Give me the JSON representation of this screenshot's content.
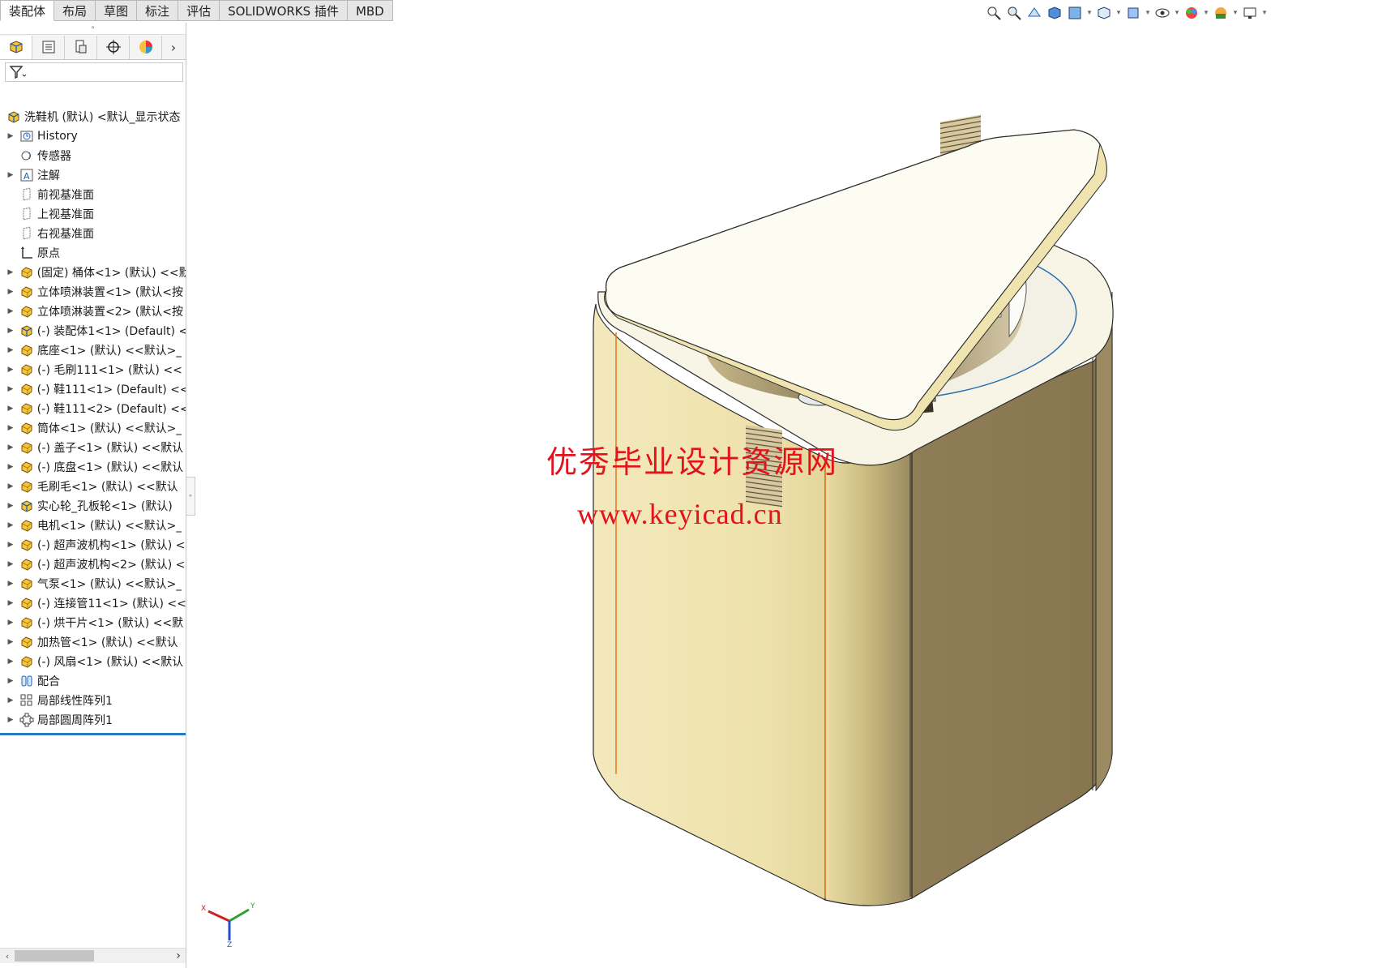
{
  "tabs": [
    {
      "label": "装配体",
      "active": true
    },
    {
      "label": "布局",
      "active": false
    },
    {
      "label": "草图",
      "active": false
    },
    {
      "label": "标注",
      "active": false
    },
    {
      "label": "评估",
      "active": false
    },
    {
      "label": "SOLIDWORKS 插件",
      "active": false
    },
    {
      "label": "MBD",
      "active": false
    }
  ],
  "view_toolbar": {
    "icons": [
      "zoom-to-fit-icon",
      "zoom-to-area-icon",
      "previous-view-icon",
      "section-view-icon",
      "dynamic-annotation-icon",
      "view-orientation-icon",
      "display-style-icon",
      "hide-show-items-icon",
      "edit-appearance-icon",
      "apply-scene-icon",
      "view-settings-icon"
    ]
  },
  "panel": {
    "manager_tabs": [
      "featuremanager-tree-icon",
      "propertymanager-icon",
      "configurationmanager-icon",
      "dimxpertmanager-icon",
      "displaymanager-icon"
    ],
    "root_label": "洗鞋机 (默认) <默认_显示状态",
    "tree": [
      {
        "label": "History",
        "icon": "history-icon",
        "expand": true
      },
      {
        "label": "传感器",
        "icon": "sensor-icon",
        "expand": false
      },
      {
        "label": "注解",
        "icon": "annotation-icon",
        "expand": true
      },
      {
        "label": "前视基准面",
        "icon": "plane-icon",
        "expand": false
      },
      {
        "label": "上视基准面",
        "icon": "plane-icon",
        "expand": false
      },
      {
        "label": "右视基准面",
        "icon": "plane-icon",
        "expand": false
      },
      {
        "label": "原点",
        "icon": "origin-icon",
        "expand": false
      },
      {
        "label": "(固定) 桶体<1> (默认) <<默",
        "icon": "part-icon",
        "expand": true
      },
      {
        "label": "立体喷淋装置<1> (默认<按",
        "icon": "part-icon",
        "expand": true
      },
      {
        "label": "立体喷淋装置<2> (默认<按",
        "icon": "part-icon",
        "expand": true
      },
      {
        "label": "(-) 装配体1<1> (Default) <",
        "icon": "subassembly-icon",
        "expand": true
      },
      {
        "label": "底座<1> (默认) <<默认>_",
        "icon": "part-icon",
        "expand": true
      },
      {
        "label": "(-) 毛刷111<1> (默认) <<",
        "icon": "part-icon",
        "expand": true
      },
      {
        "label": "(-) 鞋111<1> (Default) <<",
        "icon": "part-icon",
        "expand": true
      },
      {
        "label": "(-) 鞋111<2> (Default) <<",
        "icon": "part-icon",
        "expand": true
      },
      {
        "label": "筒体<1> (默认) <<默认>_",
        "icon": "part-icon",
        "expand": true
      },
      {
        "label": "(-) 盖子<1> (默认) <<默认",
        "icon": "part-icon",
        "expand": true
      },
      {
        "label": "(-) 底盘<1> (默认) <<默认",
        "icon": "part-icon",
        "expand": true
      },
      {
        "label": "毛刷毛<1> (默认) <<默认",
        "icon": "part-icon",
        "expand": true
      },
      {
        "label": "实心轮_孔板轮<1> (默认)",
        "icon": "subassembly-icon",
        "expand": true
      },
      {
        "label": "电机<1> (默认) <<默认>_",
        "icon": "part-icon",
        "expand": true
      },
      {
        "label": "(-) 超声波机构<1> (默认) <",
        "icon": "part-icon",
        "expand": true
      },
      {
        "label": "(-) 超声波机构<2> (默认) <",
        "icon": "part-icon",
        "expand": true
      },
      {
        "label": "气泵<1> (默认) <<默认>_",
        "icon": "part-icon",
        "expand": true
      },
      {
        "label": "(-) 连接管11<1> (默认) <<",
        "icon": "part-icon",
        "expand": true
      },
      {
        "label": "(-) 烘干片<1> (默认) <<默",
        "icon": "part-icon",
        "expand": true
      },
      {
        "label": "加热管<1> (默认) <<默认",
        "icon": "part-icon",
        "expand": true
      },
      {
        "label": "(-) 风扇<1> (默认) <<默认",
        "icon": "part-icon",
        "expand": true
      },
      {
        "label": "配合",
        "icon": "mates-icon",
        "expand": true
      },
      {
        "label": "局部线性阵列1",
        "icon": "linear-pattern-icon",
        "expand": true
      },
      {
        "label": "局部圆周阵列1",
        "icon": "circular-pattern-icon",
        "expand": true
      }
    ]
  },
  "watermark": {
    "text": "优秀毕业设计资源网",
    "url": "www.keyicad.cn",
    "color": "#e3131c"
  },
  "triad": {
    "x_label": "X",
    "y_label": "Y",
    "z_label": "Z"
  },
  "colors": {
    "body_front": "#efe4b3",
    "body_side": "#8b7a55",
    "lid": "#fdfcf3",
    "edge": "#e07a1a"
  }
}
